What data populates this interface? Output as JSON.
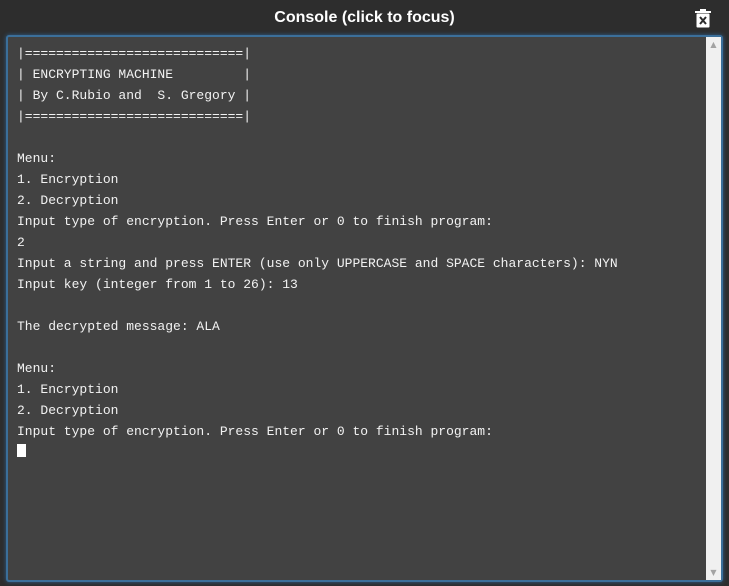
{
  "window": {
    "title": "Console (click to focus)",
    "clear_icon": "trash-icon"
  },
  "console": {
    "lines": [
      "|============================|",
      "| ENCRYPTING MACHINE         |",
      "| By C.Rubio and  S. Gregory |",
      "|============================|",
      "",
      "Menu:",
      "1. Encryption",
      "2. Decryption",
      "Input type of encryption. Press Enter or 0 to finish program:",
      "2",
      "Input a string and press ENTER (use only UPPERCASE and SPACE characters): NYN",
      "Input key (integer from 1 to 26): 13",
      "",
      "The decrypted message: ALA",
      "",
      "Menu:",
      "1. Encryption",
      "2. Decryption",
      "Input type of encryption. Press Enter or 0 to finish program:"
    ]
  },
  "scrollbar": {
    "up_icon": "▲",
    "down_icon": "▼"
  },
  "colors": {
    "console_bg": "#424242",
    "text": "#f2f2f2",
    "focus_border": "#3b6f9a",
    "titlebar_bg": "#2d2d2d"
  }
}
